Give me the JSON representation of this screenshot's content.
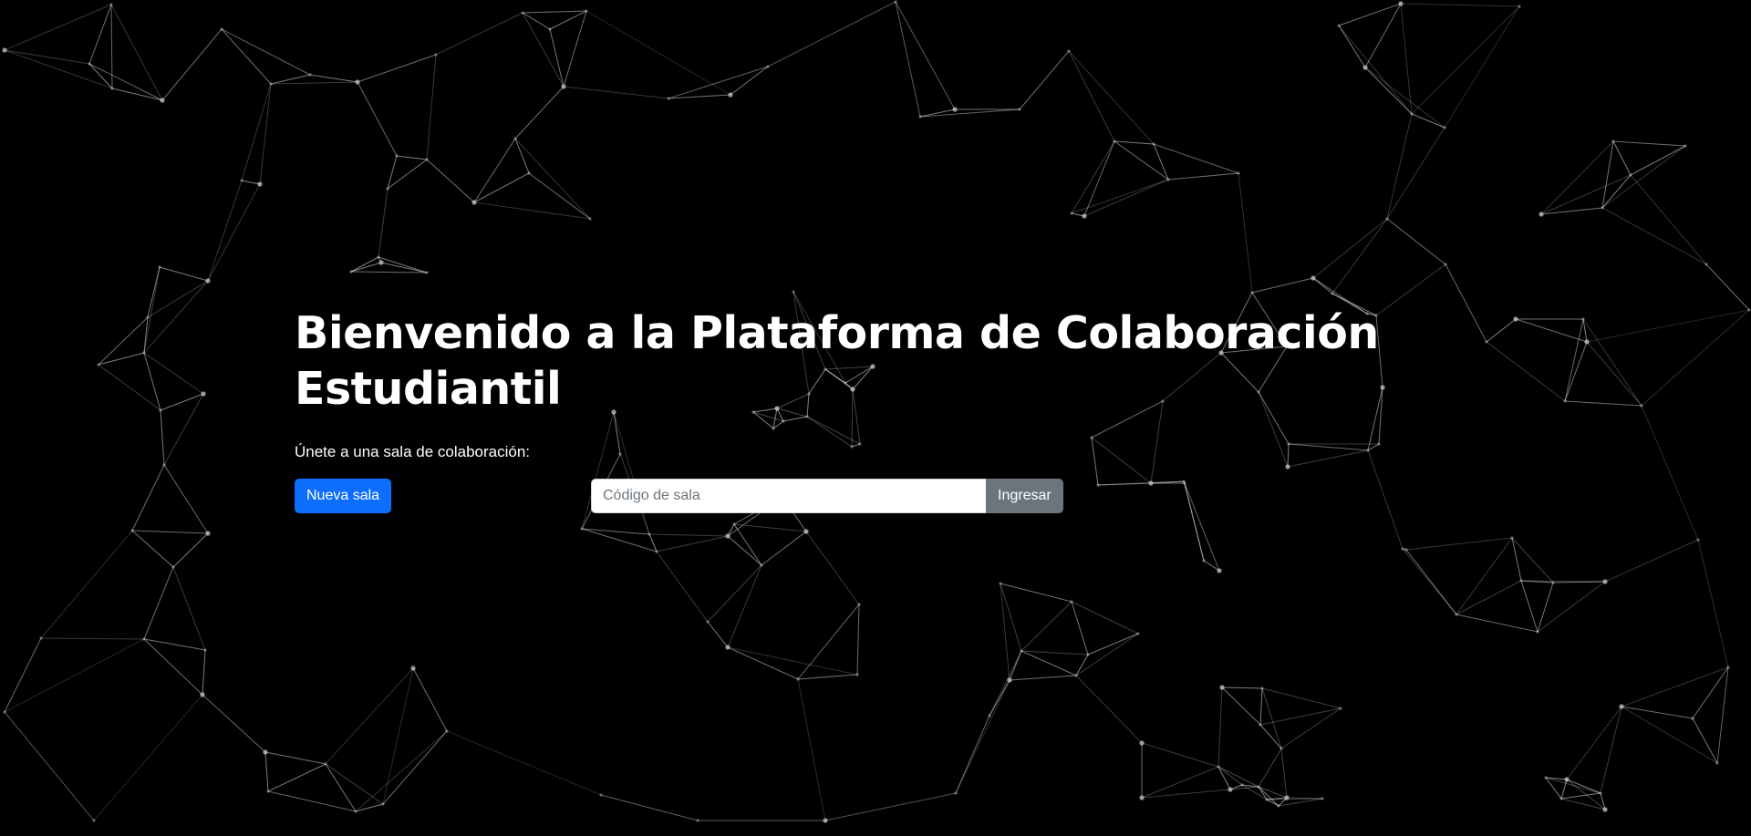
{
  "hero": {
    "title_line1": "Bienvenido a la Plataforma de Colaboración",
    "title_line2": "Estudiantil",
    "subtitle": "Únete a una sala de colaboración:"
  },
  "actions": {
    "new_room_label": "Nueva sala",
    "room_code_placeholder": "Código de sala",
    "room_code_value": "",
    "join_label": "Ingresar"
  },
  "colors": {
    "background": "#000000",
    "primary": "#0d6efd",
    "secondary": "#6c757d",
    "network": "#ffffff"
  }
}
